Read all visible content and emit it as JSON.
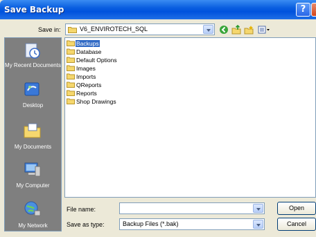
{
  "window": {
    "title": "Save Backup",
    "help_label": "?",
    "close_label": "✕"
  },
  "save_in": {
    "label": "Save in:",
    "value": "V6_ENVIROTECH_SQL"
  },
  "places": [
    {
      "label": "My Recent Documents"
    },
    {
      "label": "Desktop"
    },
    {
      "label": "My Documents"
    },
    {
      "label": "My Computer"
    },
    {
      "label": "My Network"
    }
  ],
  "folders": [
    "Backups",
    "Database",
    "Default Options",
    "Images",
    "Imports",
    "QReports",
    "Reports",
    "Shop Drawings"
  ],
  "file_name": {
    "label": "File name:",
    "value": ""
  },
  "save_type": {
    "label": "Save as type:",
    "value": "Backup Files (*.bak)"
  },
  "buttons": {
    "open": "Open",
    "cancel": "Cancel"
  },
  "colors": {
    "title_bar": "#0a5fe0",
    "dialog_bg": "#ece9d8",
    "selection": "#316ac5",
    "folder": "#f5d76e"
  }
}
